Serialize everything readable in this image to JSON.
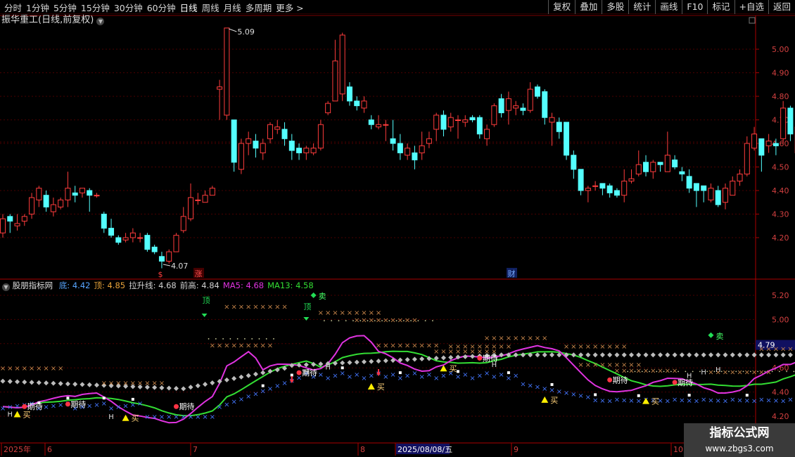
{
  "toolbar": {
    "timeframes": [
      "分时",
      "1分钟",
      "5分钟",
      "15分钟",
      "30分钟",
      "60分钟",
      "日线",
      "周线",
      "月线",
      "多周期",
      "更多 >"
    ],
    "active": "日线",
    "actions": [
      "复权",
      "叠加",
      "多股",
      "统计",
      "画线",
      "F10",
      "标记",
      "+自选",
      "返回"
    ]
  },
  "main": {
    "title": "振华重工(日线,前复权)",
    "high_label": "5.09",
    "low_label": "4.07",
    "price_ticks": [
      "5.00",
      "4.90",
      "4.80",
      "4.70",
      "4.60",
      "4.50",
      "4.40",
      "4.30",
      "4.20"
    ],
    "markers": [
      "$",
      "涨",
      "财"
    ]
  },
  "indicator": {
    "name": "股朋指标网",
    "fields": [
      {
        "label": "底:",
        "value": "4.42",
        "color": "#58a6ff"
      },
      {
        "label": "顶:",
        "value": "4.85",
        "color": "#e8a33a"
      },
      {
        "label": "拉升线:",
        "value": "4.68",
        "color": "#d0d0d0"
      },
      {
        "label": "前高:",
        "value": "4.84",
        "color": "#d0d0d0"
      },
      {
        "label": "MA5:",
        "value": "4.68",
        "color": "#e033e0"
      },
      {
        "label": "MA13:",
        "value": "4.58",
        "color": "#33dd33"
      }
    ],
    "ticks": [
      "5.20",
      "5.00",
      "4.80",
      "4.60",
      "4.40",
      "4.20"
    ],
    "current": "4.79"
  },
  "signals": {
    "buy": "买",
    "sell": "卖",
    "top": "顶",
    "wait": "期待",
    "h": "H",
    "qihuan": "期唤"
  },
  "date_axis": {
    "labels": [
      "2025年",
      "6",
      "7",
      "8",
      "2025/08/08/五",
      "9",
      "10"
    ]
  },
  "watermark": {
    "line1": "指标公式网",
    "line2": "www.zbgs3.com"
  },
  "colors": {
    "up": "#ff3c3c",
    "down": "#54ffff",
    "ma5": "#e033e0",
    "ma13": "#33dd33"
  }
}
